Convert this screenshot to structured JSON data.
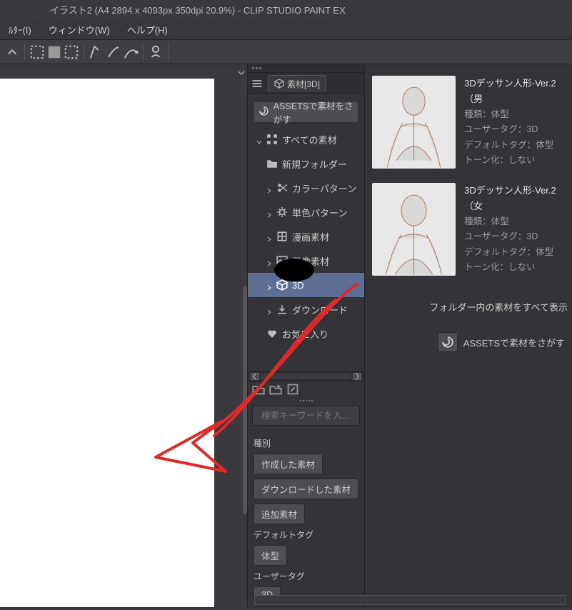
{
  "window": {
    "title": "イラスト2 (A4 2894 x 4093px 350dpi 20.9%)  - CLIP STUDIO PAINT EX"
  },
  "menu": {
    "items": [
      "ﾙﾀｰ(I)",
      "ウィンドウ(W)",
      "ヘルプ(H)"
    ]
  },
  "panel": {
    "tab_label": "素材[3D]",
    "assets_button": "ASSETSで素材をさがす",
    "tree": {
      "all_materials": "すべての素材",
      "new_folder": "新規フォルダー",
      "color_pattern": "カラーパターン",
      "mono_pattern": "単色パターン",
      "manga": "漫画素材",
      "image": "画像素材",
      "three_d": "3D",
      "download": "ダウンロード",
      "favorite": "お気に入り"
    },
    "search_placeholder": "検索キーワードを入...",
    "tags": {
      "kind_heading": "種別",
      "kind": [
        "作成した素材",
        "ダウンロードした素材",
        "追加素材"
      ],
      "default_heading": "デフォルトタグ",
      "default": [
        "体型"
      ],
      "user_heading": "ユーザータグ",
      "user": [
        "3D"
      ]
    }
  },
  "materials": [
    {
      "title": "3Dデッサン人形-Ver.2（男",
      "lines": [
        "種類：体型",
        "ユーザータグ：3D",
        "デフォルトタグ：体型",
        "トーン化：しない"
      ]
    },
    {
      "title": "3Dデッサン人形-Ver.2（女",
      "lines": [
        "種類：体型",
        "ユーザータグ：3D",
        "デフォルトタグ：体型",
        "トーン化：しない"
      ]
    }
  ],
  "list_panel": {
    "show_all": "フォルダー内の素材をすべて表示",
    "assets_label": "ASSETSで素材をさがす"
  }
}
